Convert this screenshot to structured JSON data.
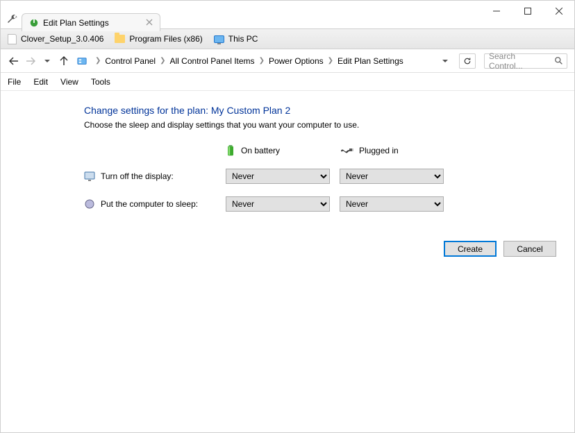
{
  "tab": {
    "title": "Edit Plan Settings"
  },
  "bookmarks": [
    {
      "label": "Clover_Setup_3.0.406",
      "icon": "blank"
    },
    {
      "label": "Program Files (x86)",
      "icon": "folder"
    },
    {
      "label": "This PC",
      "icon": "monitor"
    }
  ],
  "breadcrumbs": {
    "items": [
      "Control Panel",
      "All Control Panel Items",
      "Power Options",
      "Edit Plan Settings"
    ]
  },
  "search": {
    "placeholder": "Search Control..."
  },
  "menu": {
    "file": "File",
    "edit": "Edit",
    "view": "View",
    "tools": "Tools"
  },
  "page": {
    "title": "Change settings for the plan: My Custom Plan 2",
    "subtitle": "Choose the sleep and display settings that you want your computer to use."
  },
  "columns": {
    "battery": "On battery",
    "plugged": "Plugged in"
  },
  "rows": {
    "display": {
      "label": "Turn off the display:"
    },
    "sleep": {
      "label": "Put the computer to sleep:"
    }
  },
  "values": {
    "display_battery": "Never",
    "display_plugged": "Never",
    "sleep_battery": "Never",
    "sleep_plugged": "Never"
  },
  "options": {
    "never": "Never"
  },
  "buttons": {
    "create": "Create",
    "cancel": "Cancel"
  }
}
